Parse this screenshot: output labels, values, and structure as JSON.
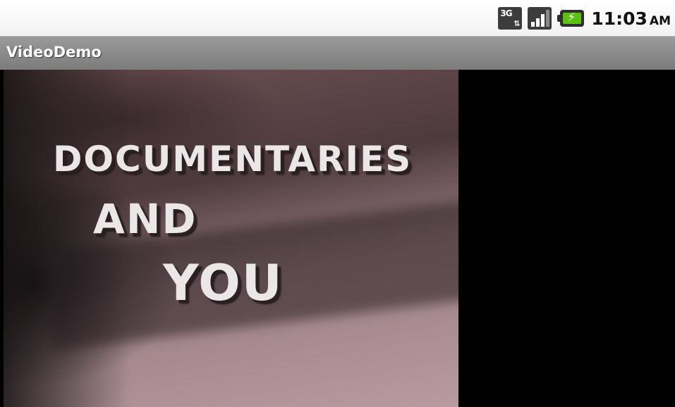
{
  "status_bar": {
    "network_type": "3G",
    "network_arrows": "⇅",
    "time": "11:03",
    "ampm": "AM",
    "icons": [
      "3g-data-icon",
      "signal-strength-icon",
      "battery-charging-icon"
    ]
  },
  "app": {
    "title": "VideoDemo"
  },
  "video": {
    "line1": "DOCUMENTARIES",
    "line2": "AND",
    "line3": "YOU"
  }
}
